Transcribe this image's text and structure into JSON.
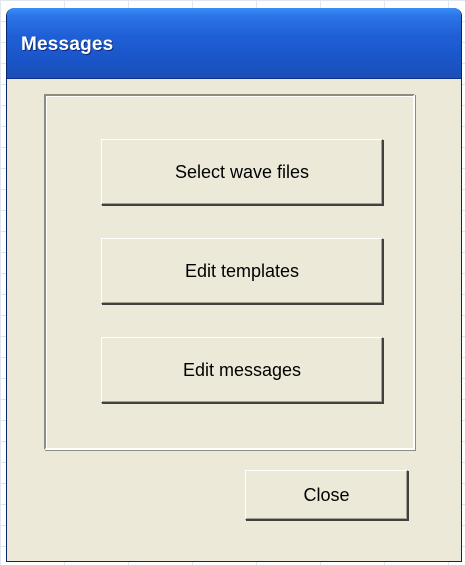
{
  "window": {
    "title": "Messages"
  },
  "buttons": {
    "select_wave_files": "Select wave files",
    "edit_templates": "Edit templates",
    "edit_messages": "Edit messages",
    "close": "Close"
  }
}
